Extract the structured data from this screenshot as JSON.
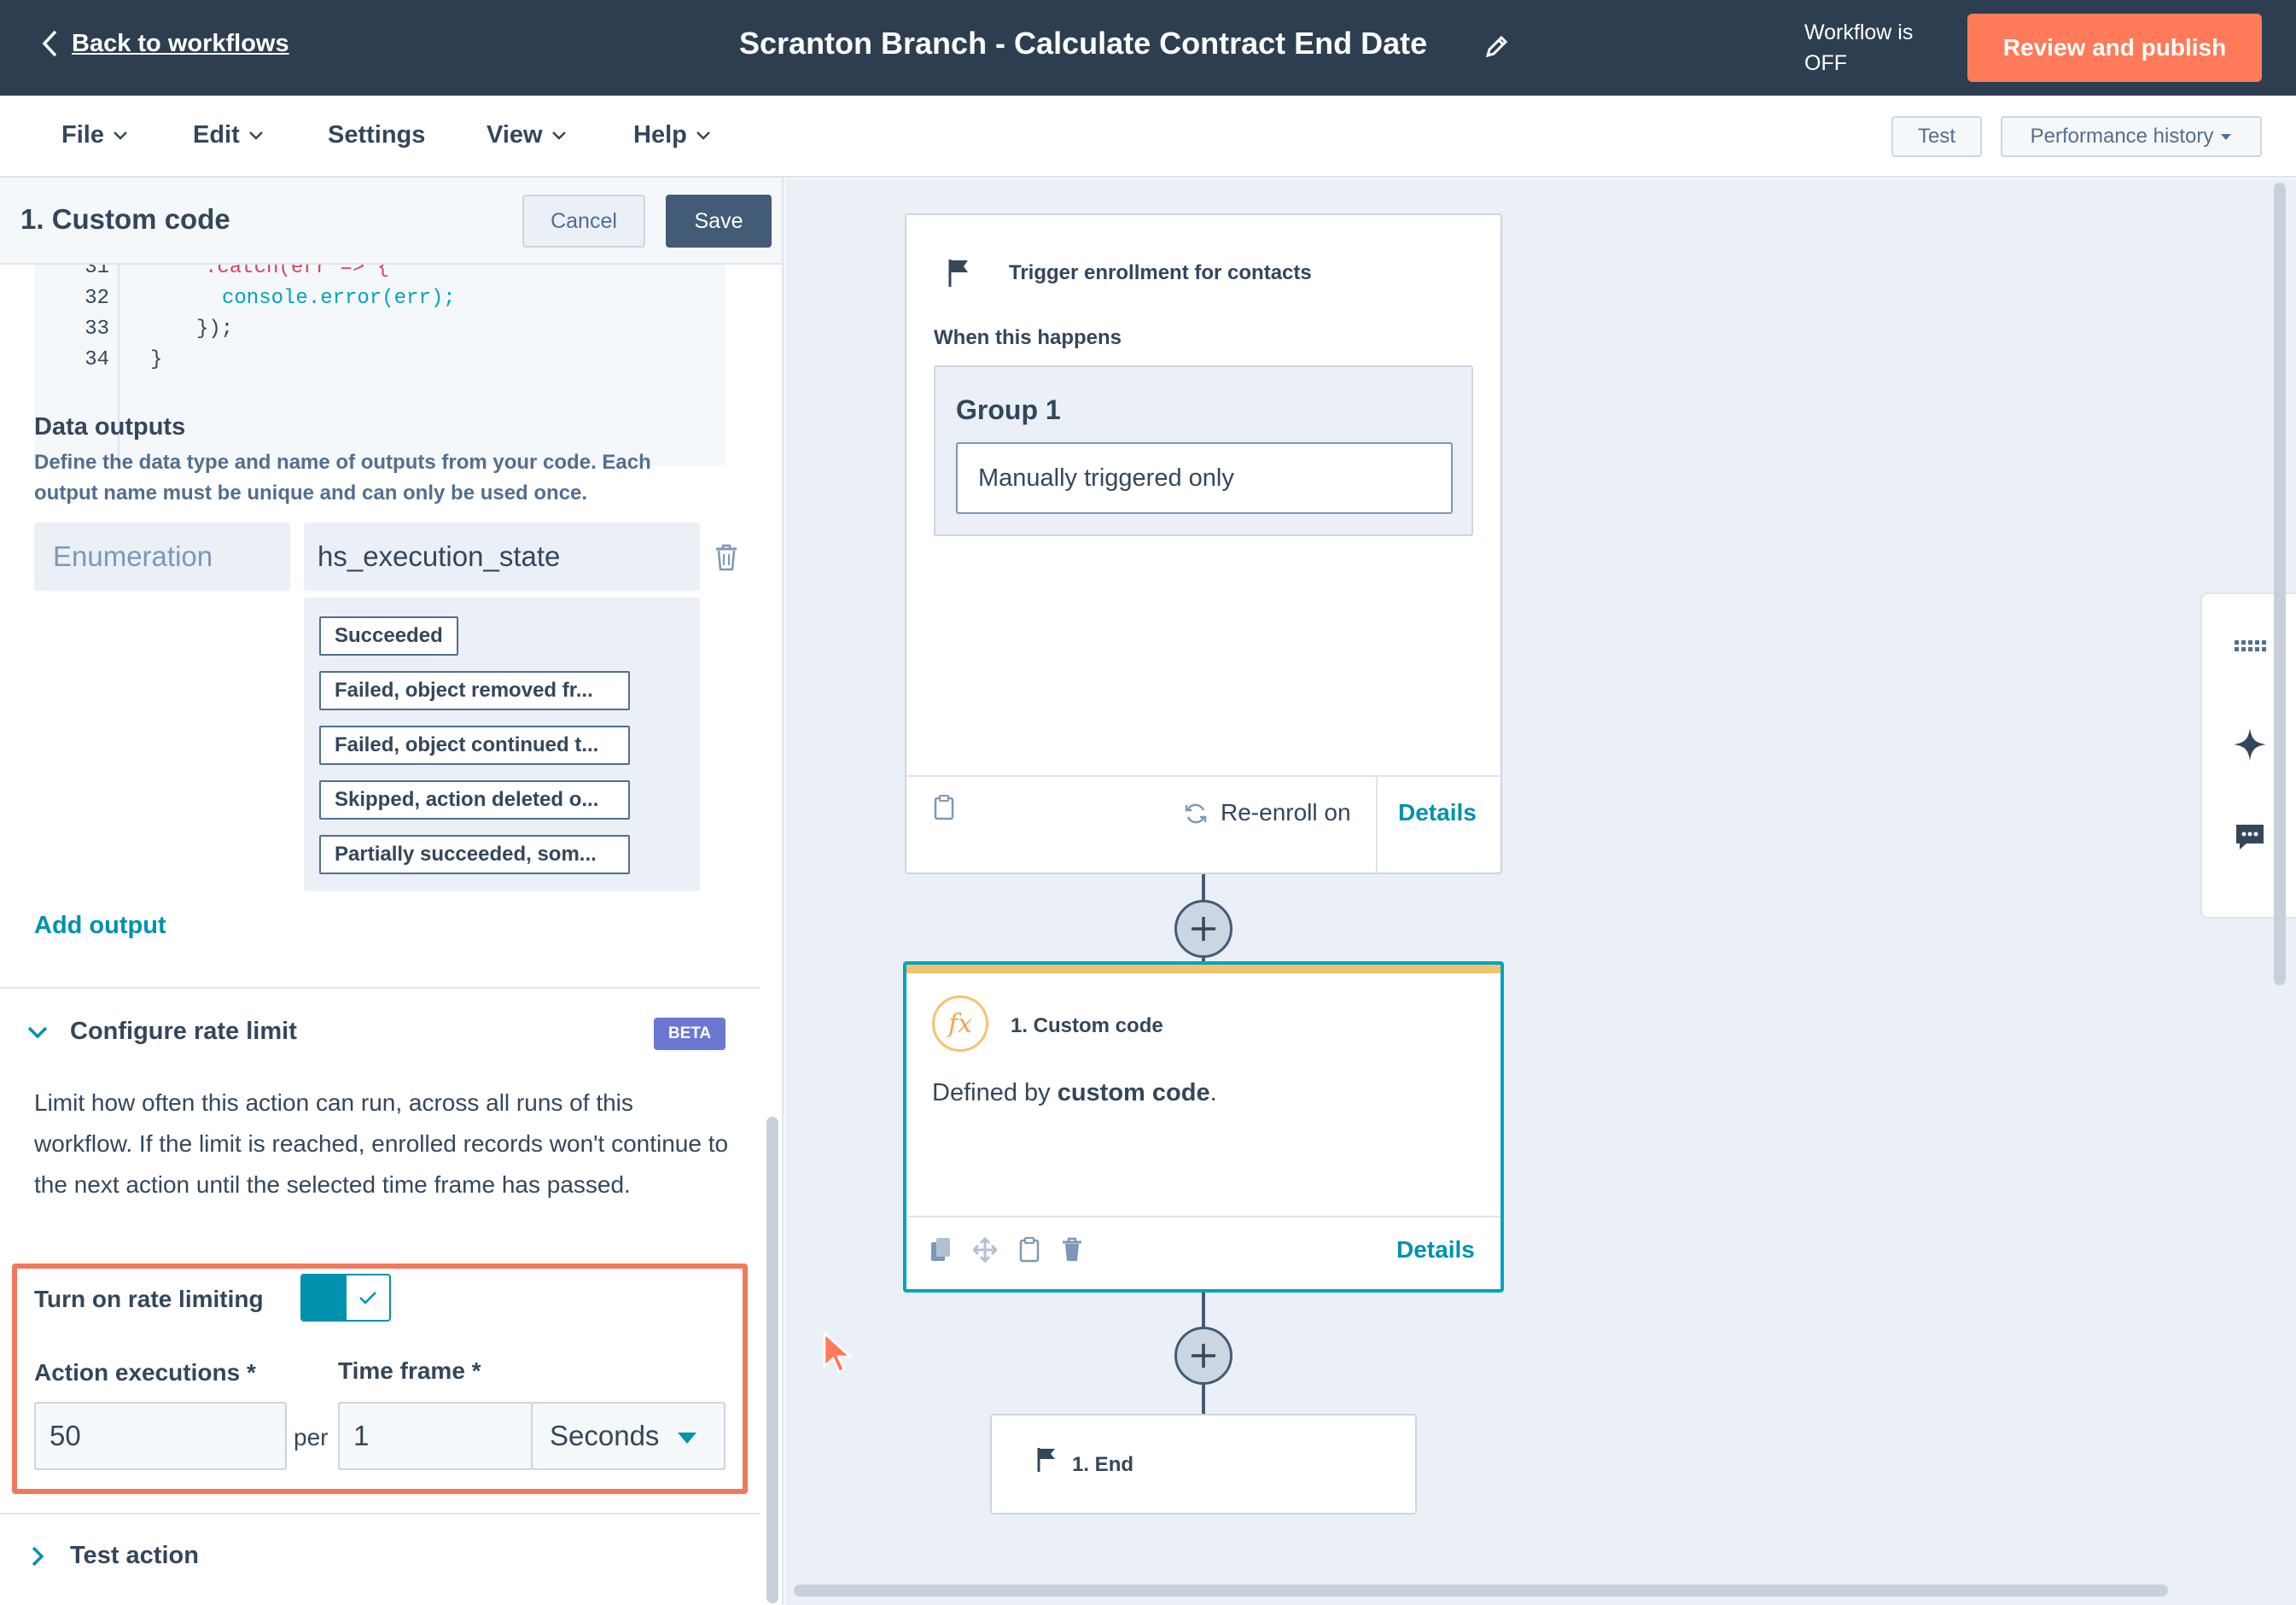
{
  "header": {
    "back_label": "Back to workflows",
    "title": "Scranton Branch - Calculate Contract End Date",
    "status_line1": "Workflow is",
    "status_line2": "OFF",
    "publish_label": "Review and publish"
  },
  "menu": {
    "file": "File",
    "edit": "Edit",
    "settings": "Settings",
    "view": "View",
    "help": "Help",
    "test": "Test",
    "performance_history": "Performance history"
  },
  "panel": {
    "title": "1. Custom code",
    "cancel": "Cancel",
    "save": "Save",
    "code": {
      "lines": [
        {
          "num": "32",
          "text": "console.error(err);"
        },
        {
          "num": "33",
          "text": "});"
        },
        {
          "num": "34",
          "text": "}"
        }
      ]
    },
    "outputs": {
      "title": "Data outputs",
      "description": "Define the data type and name of outputs from your code. Each output name must be unique and can only be used once.",
      "type": "Enumeration",
      "name": "hs_execution_state",
      "options": [
        "Succeeded",
        "Failed, object removed fr...",
        "Failed, object continued t...",
        "Skipped, action deleted o...",
        "Partially succeeded, som..."
      ],
      "add_output": "Add output"
    },
    "rate_limit": {
      "title": "Configure rate limit",
      "badge": "BETA",
      "description": "Limit how often this action can run, across all runs of this workflow. If the limit is reached, enrolled records won't continue to the next action until the selected time frame has passed.",
      "toggle_label": "Turn on rate limiting",
      "toggle_on": true,
      "executions_label": "Action executions *",
      "executions_value": "50",
      "per": "per",
      "timeframe_label": "Time frame *",
      "timeframe_value": "1",
      "timeframe_unit": "Seconds"
    },
    "test_action": "Test action"
  },
  "canvas": {
    "trigger": {
      "title": "Trigger enrollment for contacts",
      "when": "When this happens",
      "group": "Group 1",
      "criteria": "Manually triggered only",
      "reenroll": "Re-enroll on",
      "details": "Details"
    },
    "action": {
      "title": "1. Custom code",
      "desc_prefix": "Defined by ",
      "desc_bold": "custom code",
      "desc_suffix": ".",
      "details": "Details",
      "accent_color": "#f5c26b",
      "border_color": "#00a4bd"
    },
    "end": {
      "title": "1. End"
    }
  },
  "colors": {
    "header_bg": "#2d3e50",
    "primary_orange": "#ff7a59",
    "link_teal": "#0091ae",
    "highlight": "#f2785c"
  }
}
